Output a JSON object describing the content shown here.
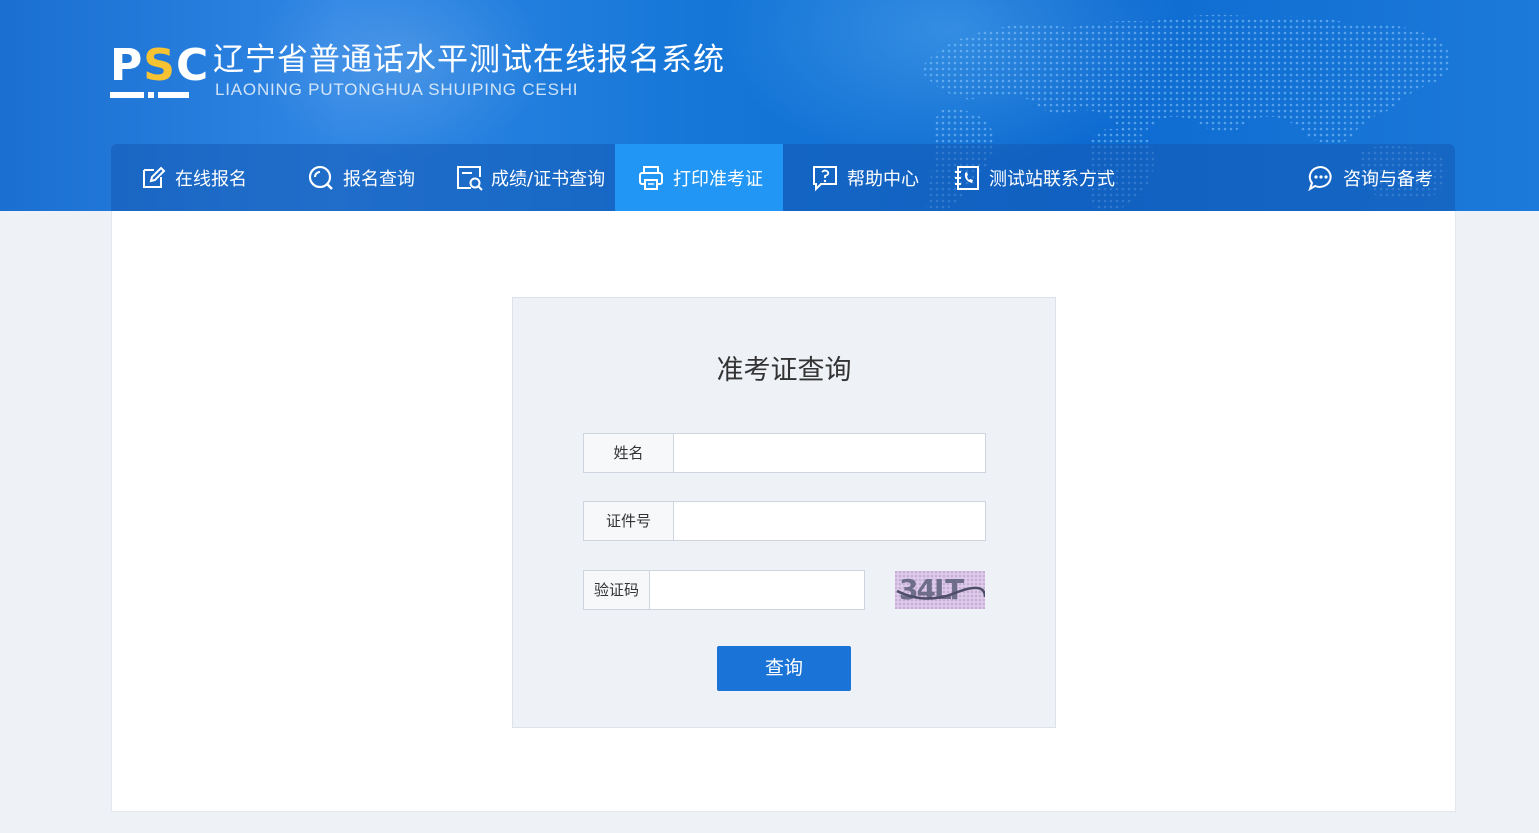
{
  "header": {
    "logo": "PSC",
    "title": "辽宁省普通话水平测试在线报名系统",
    "subtitle": "LIAONING PUTONGHUA SHUIPING CESHI"
  },
  "nav": {
    "items": [
      {
        "label": "在线报名",
        "icon": "edit-icon"
      },
      {
        "label": "报名查询",
        "icon": "search-icon"
      },
      {
        "label": "成绩/证书查询",
        "icon": "document-search-icon"
      },
      {
        "label": "打印准考证",
        "icon": "printer-icon",
        "active": true
      },
      {
        "label": "帮助中心",
        "icon": "help-icon"
      },
      {
        "label": "测试站联系方式",
        "icon": "phone-book-icon"
      },
      {
        "label": "咨询与备考",
        "icon": "chat-icon"
      }
    ]
  },
  "form": {
    "title": "准考证查询",
    "name_label": "姓名",
    "name_value": "",
    "id_label": "证件号",
    "id_value": "",
    "captcha_label": "验证码",
    "captcha_value": "",
    "captcha_text": "34LT",
    "submit_label": "查询"
  },
  "colors": {
    "header_blue": "#1677d8",
    "nav_active": "#2196f5",
    "button_blue": "#1a73d6",
    "logo_accent": "#f7c332",
    "page_bg": "#eef1f6"
  }
}
